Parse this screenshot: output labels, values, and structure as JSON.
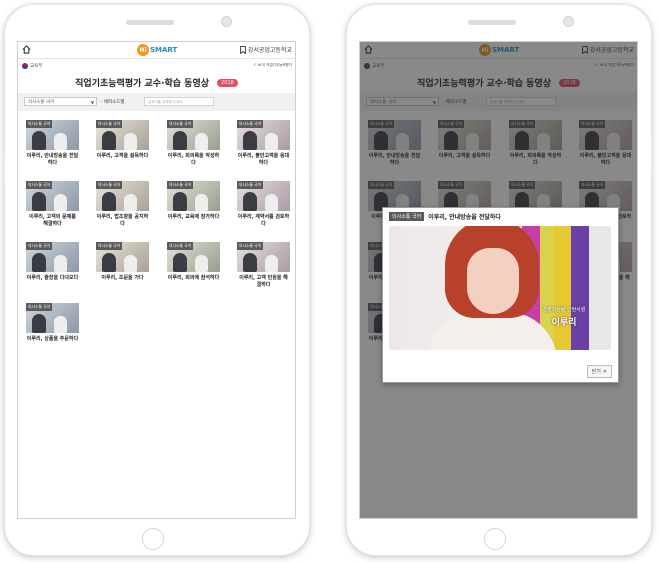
{
  "header": {
    "logo_hi": "Hi",
    "logo_smart": "SMART",
    "school": "강서공업고등학교"
  },
  "banner": {
    "ministry": "교육부",
    "partner": "NCS 직업기초능력평가",
    "title": "직업기초능력평가 교수·학습 동영상",
    "year_badge": "2018"
  },
  "filter": {
    "category_value": "의사소통 국어",
    "episode_label": "· 에피소드별",
    "episode_placeholder": "검색어를 입력해 주세요"
  },
  "videos": [
    {
      "tag": "의사소통 국어",
      "title": "이루리, 안내방송을 전달하다"
    },
    {
      "tag": "의사소통 국어",
      "title": "이루리, 고객을 설득하다"
    },
    {
      "tag": "의사소통 국어",
      "title": "이루리, 회의록을 작성하다"
    },
    {
      "tag": "의사소통 국어",
      "title": "이루리, 불만고객을 응대하다"
    },
    {
      "tag": "의사소통 국어",
      "title": "이루리, 고객의 문제를 해결하다"
    },
    {
      "tag": "의사소통 국어",
      "title": "이루리, 법조항을 공지하다"
    },
    {
      "tag": "의사소통 국어",
      "title": "이루리, 교육에 참가하다"
    },
    {
      "tag": "의사소통 국어",
      "title": "이루리, 계약서를 검토하다"
    },
    {
      "tag": "의사소통 국어",
      "title": "이루리, 출장을 다녀오다"
    },
    {
      "tag": "의사소통 국어",
      "title": "이루리, 조문을 가다"
    },
    {
      "tag": "의사소통 국어",
      "title": "이루리, 회의에 참석하다"
    },
    {
      "tag": "의사소통 국어",
      "title": "이루리, 고객 민원을 해결하다"
    },
    {
      "tag": "의사소통 국어",
      "title": "이루리, 상품을 주문하다"
    }
  ],
  "modal": {
    "tag": "의사소통 국어",
    "title": "이루리, 안내방송을 전달하다",
    "video_caption_role": "경영지원팀 인턴사원",
    "video_caption_name": "이루리",
    "close_label": "닫기",
    "close_icon": "✕"
  },
  "icons": {
    "home": "home-icon",
    "bookmark": "bookmark-icon",
    "dropdown": "chevron-down-icon"
  },
  "colors": {
    "logo_orange": "#f7931e",
    "logo_blue": "#1e8fd0",
    "year_badge": "#e74c5b",
    "tag_bg": "#5a5a5a"
  }
}
